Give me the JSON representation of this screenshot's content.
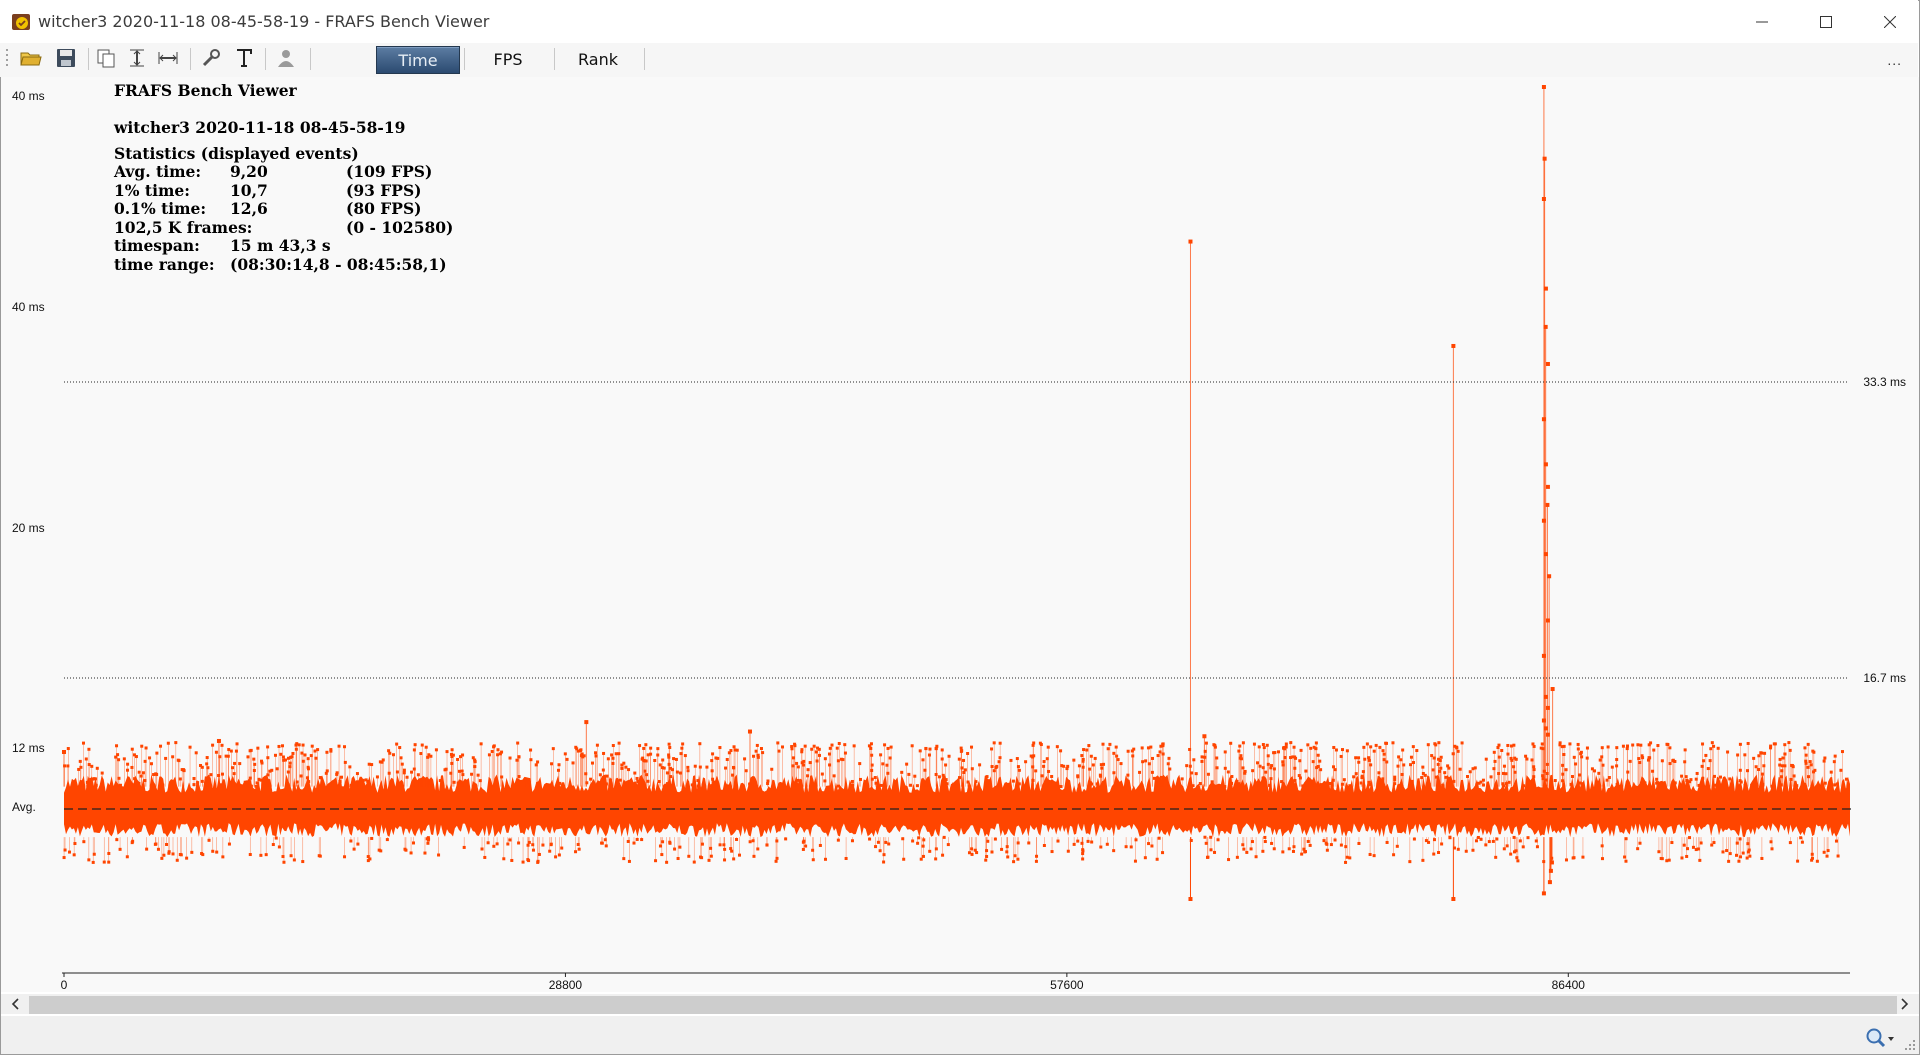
{
  "window": {
    "title": "witcher3 2020-11-18 08-45-58-19 - FRAFS Bench Viewer",
    "controls": [
      "minimize-icon",
      "maximize-icon",
      "close-icon"
    ]
  },
  "toolbar": {
    "icons": [
      "open-folder-icon",
      "save-icon",
      "copy-icon",
      "fit-vertical-icon",
      "fit-horizontal-icon",
      "settings-wrench-icon",
      "text-icon",
      "user-icon"
    ],
    "tabs": [
      {
        "label": "Time",
        "active": true
      },
      {
        "label": "FPS",
        "active": false
      },
      {
        "label": "Rank",
        "active": false
      }
    ],
    "overflow": "..."
  },
  "stats": {
    "app_name": "FRAFS Bench Viewer",
    "file_name": "witcher3 2020-11-18 08-45-58-19",
    "section": "Statistics (displayed events)",
    "rows": [
      {
        "label": "Avg. time:",
        "value": "9,20",
        "extra": "(109 FPS)"
      },
      {
        "label": "1% time:",
        "value": "10,7",
        "extra": "(93 FPS)"
      },
      {
        "label": "0.1% time:",
        "value": "12,6",
        "extra": "(80 FPS)"
      },
      {
        "label": "102,5 K frames:",
        "value": "",
        "extra": "(0 - 102580)"
      },
      {
        "label": "timespan:",
        "value": "15 m 43,3 s",
        "extra": ""
      },
      {
        "label": "time range:",
        "value": "(08:30:14,8 - 08:45:58,1)",
        "extra": ""
      }
    ]
  },
  "chart_data": {
    "type": "line",
    "title": "",
    "xlabel": "",
    "ylabel": "",
    "xlim": [
      0,
      102580
    ],
    "x_ticks": [
      "0",
      "28800",
      "57600",
      "86400"
    ],
    "x_tick_values": [
      0,
      28800,
      57600,
      86400
    ],
    "y_tick_labels": [
      "40 ms",
      "40 ms",
      "20 ms",
      "12 ms",
      "Avg."
    ],
    "reference_lines": [
      {
        "label": "33.3 ms",
        "value": 33.3,
        "style": "dotted"
      },
      {
        "label": "16.7 ms",
        "value": 16.7,
        "style": "dotted"
      },
      {
        "label": "Avg.",
        "value": 9.2,
        "style": "dashed"
      }
    ],
    "series_color": "#ff4500",
    "band": {
      "typical_min": 8.2,
      "typical_max": 10.3,
      "common_spike_max": 12.6
    },
    "spikes": [
      {
        "x": 0,
        "y": 12.0
      },
      {
        "x": 8900,
        "y": 12.7
      },
      {
        "x": 30000,
        "y": 13.9
      },
      {
        "x": 39400,
        "y": 13.3
      },
      {
        "x": 64700,
        "y": 46.2,
        "dip": 5.9
      },
      {
        "x": 65500,
        "y": 13.0
      },
      {
        "x": 79800,
        "y": 36.7,
        "dip": 6.0
      },
      {
        "x": 85000,
        "y": 60.0,
        "dip": 6.2
      },
      {
        "x": 85040,
        "y": 53.6
      },
      {
        "x": 85100,
        "y": 38.5
      },
      {
        "x": 85200,
        "y": 22.4
      },
      {
        "x": 85300,
        "y": 19.0
      },
      {
        "x": 85500,
        "y": 16.0
      }
    ]
  }
}
